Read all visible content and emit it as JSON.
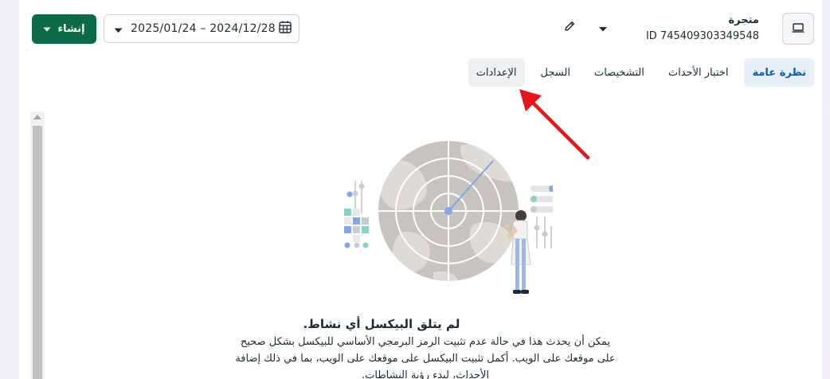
{
  "header": {
    "pixel_name": "متجرة",
    "pixel_id": "ID 745409303349548",
    "date_range": "2025/01/24 – 2024/12/28",
    "create_label": "إنشاء",
    "icons": {
      "device": "laptop-icon",
      "edit": "pencil-icon",
      "calendar": "calendar-icon",
      "dropdown": "chevron-down-icon"
    }
  },
  "tabs": [
    {
      "label": "نظرة عامة",
      "state": "active"
    },
    {
      "label": "اختبار الأحداث",
      "state": "normal"
    },
    {
      "label": "التشخيصات",
      "state": "normal"
    },
    {
      "label": "السجل",
      "state": "normal"
    },
    {
      "label": "الإعدادات",
      "state": "hover"
    }
  ],
  "empty_state": {
    "title": "لم يتلق البيكسل أي نشاط.",
    "description": "يمكن أن يحدث هذا في حالة عدم تثبيت الرمز البرمجي الأساسي للبيكسل بشكل صحيح على موقعك على الويب. أكمل تثبيت البيكسل على موقعك على الويب، بما في ذلك إضافة الأحداث، لبدء رؤية النشاطات."
  },
  "colors": {
    "primary_button": "#0a6b46",
    "active_tab_bg": "#e7f0fa",
    "active_tab_text": "#0a5bb5",
    "annotation_arrow": "#e8141b"
  }
}
